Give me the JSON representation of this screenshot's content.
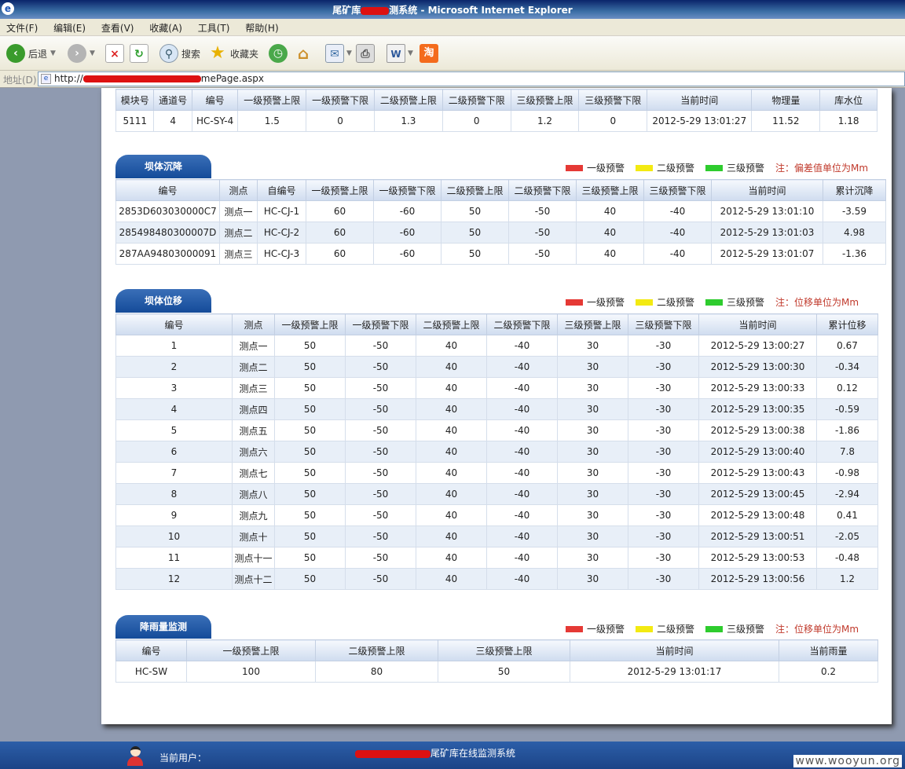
{
  "window": {
    "title_prefix": "尾矿库",
    "title_suffix": "测系统 - Microsoft Internet Explorer"
  },
  "menu": [
    "文件(F)",
    "编辑(E)",
    "查看(V)",
    "收藏(A)",
    "工具(T)",
    "帮助(H)"
  ],
  "toolbar": {
    "back": "后退",
    "search": "搜索",
    "favorites": "收藏夹"
  },
  "address": {
    "label": "地址(D)",
    "prefix": "http://",
    "suffix": "mePage.aspx"
  },
  "channel_table": {
    "headers": [
      "模块号",
      "通道号",
      "编号",
      "一级预警上限",
      "一级预警下限",
      "二级预警上限",
      "二级预警下限",
      "三级预警上限",
      "三级预警下限",
      "当前时间",
      "物理量",
      "库水位"
    ],
    "rows": [
      [
        "5111",
        "4",
        "HC-SY-4",
        "1.5",
        "0",
        "1.3",
        "0",
        "1.2",
        "0",
        "2012-5-29 13:01:27",
        "11.52",
        "1.18"
      ]
    ]
  },
  "legend": {
    "level1": "一级预警",
    "level2": "二级预警",
    "level3": "三级预警",
    "level1_color": "#e53935",
    "level2_color": "#f3ea12",
    "level3_color": "#2ecc2e"
  },
  "settlement": {
    "title": "坝体沉降",
    "note": "注：偏差值单位为Mm",
    "headers": [
      "编号",
      "测点",
      "自编号",
      "一级预警上限",
      "一级预警下限",
      "二级预警上限",
      "二级预警下限",
      "三级预警上限",
      "三级预警下限",
      "当前时间",
      "累计沉降"
    ],
    "rows": [
      [
        "2853D603030000C7",
        "测点一",
        "HC-CJ-1",
        "60",
        "-60",
        "50",
        "-50",
        "40",
        "-40",
        "2012-5-29 13:01:10",
        "-3.59"
      ],
      [
        "285498480300007D",
        "测点二",
        "HC-CJ-2",
        "60",
        "-60",
        "50",
        "-50",
        "40",
        "-40",
        "2012-5-29 13:01:03",
        "4.98"
      ],
      [
        "287AA94803000091",
        "测点三",
        "HC-CJ-3",
        "60",
        "-60",
        "50",
        "-50",
        "40",
        "-40",
        "2012-5-29 13:01:07",
        "-1.36"
      ]
    ]
  },
  "displacement": {
    "title": "坝体位移",
    "note": "注：位移单位为Mm",
    "headers": [
      "编号",
      "测点",
      "一级预警上限",
      "一级预警下限",
      "二级预警上限",
      "二级预警下限",
      "三级预警上限",
      "三级预警下限",
      "当前时间",
      "累计位移"
    ],
    "rows": [
      [
        "1",
        "测点一",
        "50",
        "-50",
        "40",
        "-40",
        "30",
        "-30",
        "2012-5-29 13:00:27",
        "0.67"
      ],
      [
        "2",
        "测点二",
        "50",
        "-50",
        "40",
        "-40",
        "30",
        "-30",
        "2012-5-29 13:00:30",
        "-0.34"
      ],
      [
        "3",
        "测点三",
        "50",
        "-50",
        "40",
        "-40",
        "30",
        "-30",
        "2012-5-29 13:00:33",
        "0.12"
      ],
      [
        "4",
        "测点四",
        "50",
        "-50",
        "40",
        "-40",
        "30",
        "-30",
        "2012-5-29 13:00:35",
        "-0.59"
      ],
      [
        "5",
        "测点五",
        "50",
        "-50",
        "40",
        "-40",
        "30",
        "-30",
        "2012-5-29 13:00:38",
        "-1.86"
      ],
      [
        "6",
        "测点六",
        "50",
        "-50",
        "40",
        "-40",
        "30",
        "-30",
        "2012-5-29 13:00:40",
        "7.8"
      ],
      [
        "7",
        "测点七",
        "50",
        "-50",
        "40",
        "-40",
        "30",
        "-30",
        "2012-5-29 13:00:43",
        "-0.98"
      ],
      [
        "8",
        "测点八",
        "50",
        "-50",
        "40",
        "-40",
        "30",
        "-30",
        "2012-5-29 13:00:45",
        "-2.94"
      ],
      [
        "9",
        "测点九",
        "50",
        "-50",
        "40",
        "-40",
        "30",
        "-30",
        "2012-5-29 13:00:48",
        "0.41"
      ],
      [
        "10",
        "测点十",
        "50",
        "-50",
        "40",
        "-40",
        "30",
        "-30",
        "2012-5-29 13:00:51",
        "-2.05"
      ],
      [
        "11",
        "测点十一",
        "50",
        "-50",
        "40",
        "-40",
        "30",
        "-30",
        "2012-5-29 13:00:53",
        "-0.48"
      ],
      [
        "12",
        "测点十二",
        "50",
        "-50",
        "40",
        "-40",
        "30",
        "-30",
        "2012-5-29 13:00:56",
        "1.2"
      ]
    ]
  },
  "rainfall": {
    "title": "降雨量监测",
    "note": "注：位移单位为Mm",
    "headers": [
      "编号",
      "一级预警上限",
      "二级预警上限",
      "三级预警上限",
      "当前时间",
      "当前雨量"
    ],
    "rows": [
      [
        "HC-SW",
        "100",
        "80",
        "50",
        "2012-5-29 13:01:17",
        "0.2"
      ]
    ]
  },
  "footer": {
    "user_label": "当前用户：",
    "system_name": "尾矿库在线监测系统",
    "watermark": "www.wooyun.org"
  }
}
